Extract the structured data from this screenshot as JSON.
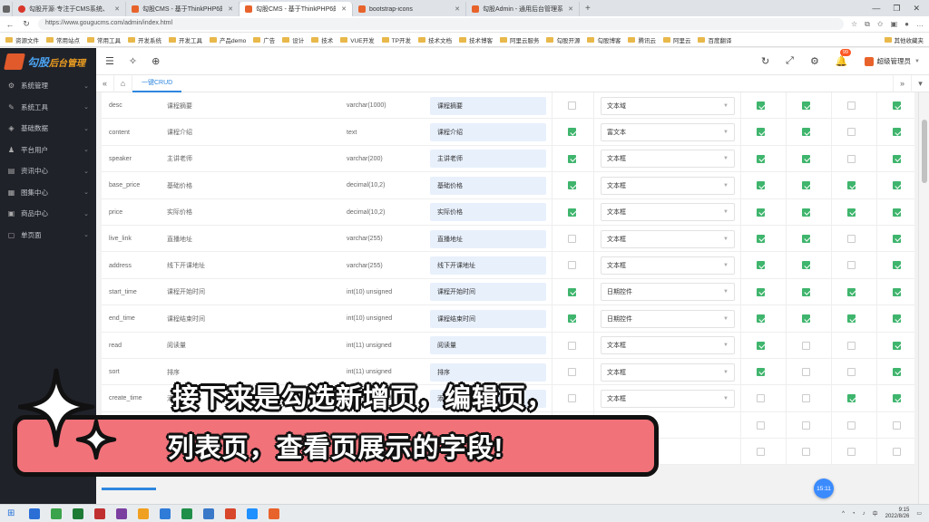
{
  "browser": {
    "tabs": [
      {
        "title": "勾股开源·专注于CMS系统、OA…",
        "favicon": "red"
      },
      {
        "title": "勾股CMS - 基于ThinkPHP6的开源…",
        "favicon": "orange"
      },
      {
        "title": "勾股CMS - 基于ThinkPHP6的开源…",
        "favicon": "orange",
        "active": true
      },
      {
        "title": "bootstrap-icons",
        "favicon": "orange"
      },
      {
        "title": "勾股Admin - 通用后台管理系统…",
        "favicon": "orange"
      }
    ],
    "url": "https://www.gougucms.com/admin/index.html",
    "bookmarks": [
      "资源文件",
      "常用站点",
      "常用工具",
      "开发系统",
      "开发工具",
      "产品demo",
      "广告",
      "设计",
      "技术",
      "VUE开发",
      "TP开发",
      "技术文档",
      "技术博客",
      "阿里云服务",
      "勾股开源",
      "勾股博客",
      "腾讯云",
      "阿里云",
      "百度翻译"
    ],
    "bookmarks_right": "其他收藏夹"
  },
  "admin": {
    "logo_main": "勾股",
    "logo_sub": "后台管理",
    "notification_count": "99",
    "user_name": "超级管理员",
    "sidebar": [
      {
        "label": "系统管理",
        "icon": "⚙"
      },
      {
        "label": "系统工具",
        "icon": "✎"
      },
      {
        "label": "基础数据",
        "icon": "◈"
      },
      {
        "label": "平台用户",
        "icon": "♟"
      },
      {
        "label": "资讯中心",
        "icon": "▤"
      },
      {
        "label": "图集中心",
        "icon": "▦"
      },
      {
        "label": "商品中心",
        "icon": "▣"
      },
      {
        "label": "单页面",
        "icon": "▢"
      }
    ],
    "page_tab": "一键CRUD"
  },
  "fields": [
    {
      "name": "desc",
      "comment": "课程摘要",
      "type": "varchar(1000)",
      "label": "课程摘要",
      "c1": false,
      "control": "文本域",
      "c2": true,
      "c3": true,
      "c4": false,
      "c5": true
    },
    {
      "name": "content",
      "comment": "课程介绍",
      "type": "text",
      "label": "课程介绍",
      "c1": true,
      "control": "富文本",
      "c2": true,
      "c3": true,
      "c4": false,
      "c5": true
    },
    {
      "name": "speaker",
      "comment": "主讲老师",
      "type": "varchar(200)",
      "label": "主讲老师",
      "c1": true,
      "control": "文本框",
      "c2": true,
      "c3": true,
      "c4": false,
      "c5": true
    },
    {
      "name": "base_price",
      "comment": "基础价格",
      "type": "decimal(10,2)",
      "label": "基础价格",
      "c1": true,
      "control": "文本框",
      "c2": true,
      "c3": true,
      "c4": true,
      "c5": true
    },
    {
      "name": "price",
      "comment": "实际价格",
      "type": "decimal(10,2)",
      "label": "实际价格",
      "c1": true,
      "control": "文本框",
      "c2": true,
      "c3": true,
      "c4": true,
      "c5": true
    },
    {
      "name": "live_link",
      "comment": "直播地址",
      "type": "varchar(255)",
      "label": "直播地址",
      "c1": false,
      "control": "文本框",
      "c2": true,
      "c3": true,
      "c4": false,
      "c5": true
    },
    {
      "name": "address",
      "comment": "线下开课地址",
      "type": "varchar(255)",
      "label": "线下开课地址",
      "c1": false,
      "control": "文本框",
      "c2": true,
      "c3": true,
      "c4": false,
      "c5": true
    },
    {
      "name": "start_time",
      "comment": "课程开始时间",
      "type": "int(10) unsigned",
      "label": "课程开始时间",
      "c1": true,
      "control": "日期控件",
      "c2": true,
      "c3": true,
      "c4": true,
      "c5": true
    },
    {
      "name": "end_time",
      "comment": "课程结束时间",
      "type": "int(10) unsigned",
      "label": "课程结束时间",
      "c1": true,
      "control": "日期控件",
      "c2": true,
      "c3": true,
      "c4": true,
      "c5": true
    },
    {
      "name": "read",
      "comment": "阅读量",
      "type": "int(11) unsigned",
      "label": "阅读量",
      "c1": false,
      "control": "文本框",
      "c2": true,
      "c3": false,
      "c4": false,
      "c5": true
    },
    {
      "name": "sort",
      "comment": "排序",
      "type": "int(11) unsigned",
      "label": "排序",
      "c1": false,
      "control": "文本框",
      "c2": true,
      "c3": false,
      "c4": false,
      "c5": true
    },
    {
      "name": "create_time",
      "comment": "添加时间",
      "type": "int(11) unsigned",
      "label": "添加时间",
      "c1": false,
      "control": "文本框",
      "c2": false,
      "c3": false,
      "c4": true,
      "c5": true
    },
    {
      "name": "",
      "comment": "",
      "type": "",
      "label": "",
      "c1": false,
      "control": "",
      "c2": false,
      "c3": false,
      "c4": false,
      "c5": false
    },
    {
      "name": "",
      "comment": "",
      "type": "",
      "label": "",
      "c1": false,
      "control": "",
      "c2": false,
      "c3": false,
      "c4": false,
      "c5": false
    }
  ],
  "timer": "15:11",
  "caption": {
    "line1": "接下来是勾选新增页，编辑页，",
    "line2": "列表页，查看页展示的字段!"
  },
  "taskbar": {
    "time": "9:15",
    "date": "2022/8/26",
    "app_colors": [
      "#2b6fd6",
      "#3ba34b",
      "#1e7b34",
      "#c03030",
      "#7b3fa0",
      "#f0a020",
      "#2f7bd8",
      "#1f8f4a",
      "#3a78c8",
      "#d8462b",
      "#1e90ff",
      "#e8632b"
    ]
  },
  "colors": {
    "check": "#3fb56d",
    "accent": "#2e86de",
    "sidebar": "#20222a",
    "caption_pill": "#f2727a"
  }
}
